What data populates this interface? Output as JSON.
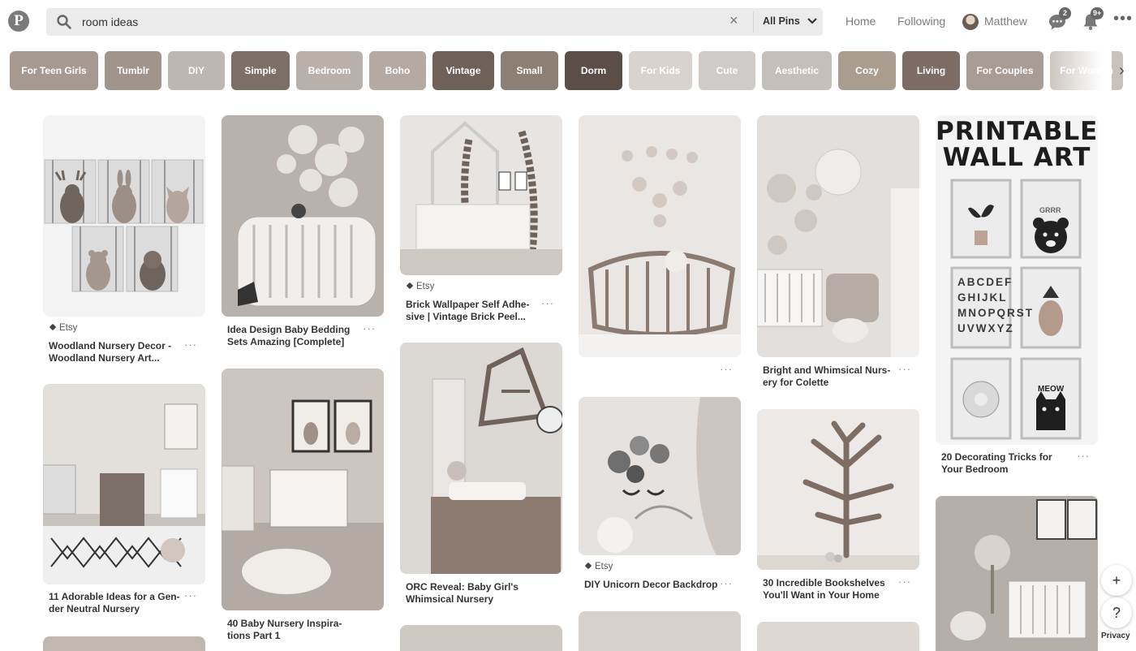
{
  "header": {
    "logo": "P",
    "search_query": "room ideas",
    "search_clear": "×",
    "scope_label": "All Pins",
    "nav": {
      "home": "Home",
      "following": "Following",
      "profile_name": "Matthew"
    },
    "messages_badge": "2",
    "notifications_badge": "9+",
    "more": "•••"
  },
  "guides": [
    {
      "label": "For Teen Girls",
      "color": "#a69a90"
    },
    {
      "label": "Tumblr",
      "color": "#a0948b"
    },
    {
      "label": "DIY",
      "color": "#bdb6b1"
    },
    {
      "label": "Simple",
      "color": "#7d6e66"
    },
    {
      "label": "Bedroom",
      "color": "#b9b0aa"
    },
    {
      "label": "Boho",
      "color": "#b4aaa2"
    },
    {
      "label": "Vintage",
      "color": "#6f6058"
    },
    {
      "label": "Small",
      "color": "#8e7f74"
    },
    {
      "label": "Dorm",
      "color": "#5c4e47"
    },
    {
      "label": "For Kids",
      "color": "#d8d3cf"
    },
    {
      "label": "Cute",
      "color": "#cfcbc8"
    },
    {
      "label": "Aesthetic",
      "color": "#c4bfba"
    },
    {
      "label": "Cozy",
      "color": "#ab9c90"
    },
    {
      "label": "Living",
      "color": "#7c6c63"
    },
    {
      "label": "For Couples",
      "color": "#a89d94"
    },
    {
      "label": "For Women",
      "color": "#c9c2bc"
    }
  ],
  "pins": {
    "woodland": {
      "source": "Etsy",
      "title": "Woodland Nursery Decor -\nWoodland Nursery Art...",
      "more": "···"
    },
    "idea_design": {
      "title": "Idea Design Baby Bedding\nSets Amazing [Complete]",
      "more": "···"
    },
    "brick": {
      "source": "Etsy",
      "title": "Brick Wallpaper Self Adhe-\nsive | Vintage Brick Peel...",
      "more": "···"
    },
    "mobile": {
      "more": "···"
    },
    "colette": {
      "title": "Bright and Whimsical Nurs-\nery for Colette",
      "more": "···"
    },
    "printable": {
      "art_text": "PRINTABLE\nWALL ART",
      "title": "20 Decorating Tricks for\nYour Bedroom",
      "more": "···",
      "poster_letters": "ABCDEF\nGHIJKL\nMNOPQRST\nUVWXYZ",
      "poster_grrr": "GRRR",
      "poster_meow": "MEOW"
    },
    "adorable": {
      "title": "11 Adorable Ideas for a Gen-\nder Neutral Nursery",
      "more": "···"
    },
    "baby40": {
      "title": "40 Baby Nursery Inspira-\ntions Part 1",
      "more": "···"
    },
    "orc": {
      "title": "ORC Reveal: Baby Girl's\nWhimsical Nursery",
      "more": "···"
    },
    "unicorn": {
      "source": "Etsy",
      "title": "DIY Unicorn Decor Backdrop",
      "more": "···"
    },
    "bookshelves": {
      "title": "30 Incredible Bookshelves\nYou'll Want in Your Home",
      "more": "···"
    }
  },
  "controls": {
    "add": "+",
    "help": "?",
    "privacy": "Privacy"
  },
  "colors": {
    "accent": "#666666",
    "text": "#333333",
    "search_bg": "#ebebeb"
  }
}
